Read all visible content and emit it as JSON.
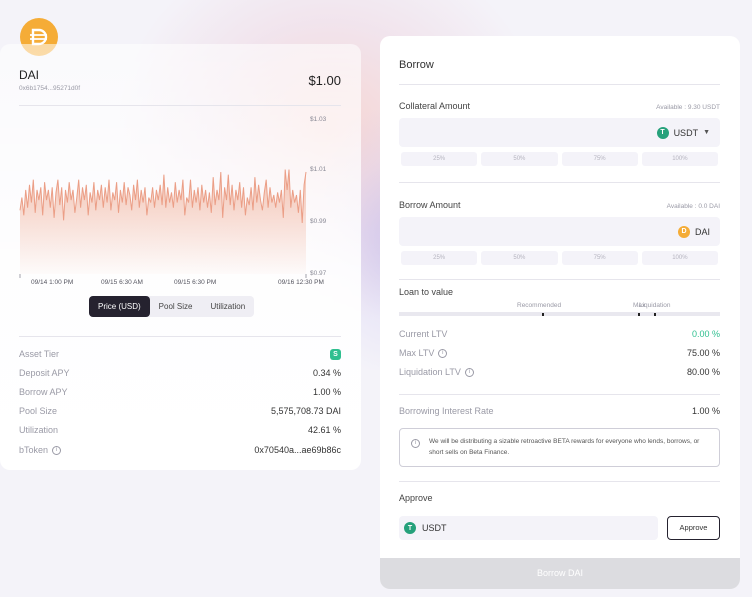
{
  "asset": {
    "name": "DAI",
    "address": "0x6b1754...95271d0f",
    "price": "$1.00",
    "brand_color": "#f5ac37"
  },
  "chart_data": {
    "type": "area",
    "x_tick_labels": [
      "09/14 1:00 PM",
      "09/15 6:30 AM",
      "09/15 6:30 PM",
      "09/16 12:30 PM"
    ],
    "y_tick_labels": [
      "$1.03",
      "$1.01",
      "$0.99",
      "$0.97"
    ],
    "ylim": [
      0.97,
      1.03
    ],
    "fill_color": "#f3c2b1",
    "line_color": "#eb9e86",
    "values": [
      0.995,
      1.0,
      0.993,
      1.003,
      0.996,
      1.005,
      0.998,
      1.007,
      0.994,
      1.003,
      0.999,
      1.004,
      0.993,
      1.006,
      0.999,
      1.003,
      0.996,
      1.004,
      0.992,
      1.002,
      1.007,
      0.997,
      1.004,
      0.991,
      1.003,
      0.998,
      1.006,
      0.999,
      1.003,
      0.994,
      1.0,
      1.007,
      0.996,
      1.004,
      0.999,
      1.005,
      0.993,
      1.002,
      0.998,
      1.006,
      0.995,
      1.003,
      0.999,
      1.005,
      0.996,
      1.004,
      0.998,
      1.007,
      0.995,
      1.002,
      0.999,
      1.006,
      0.994,
      1.003,
      0.998,
      1.006,
      0.997,
      1.004,
      1.001,
      0.995,
      1.005,
      0.999,
      1.007,
      0.996,
      1.003,
      0.998,
      1.004,
      0.993,
      1.0,
      0.998,
      1.004,
      0.996,
      1.003,
      0.999,
      1.005,
      0.997,
      1.009,
      0.996,
      1.004,
      0.998,
      1.002,
      0.996,
      1.006,
      0.998,
      1.003,
      0.999,
      1.007,
      0.993,
      1.0,
      0.998,
      1.007,
      0.996,
      1.003,
      0.998,
      1.004,
      0.995,
      1.005,
      0.998,
      1.003,
      0.996,
      1.002,
      0.994,
      1.008,
      0.997,
      1.003,
      0.999,
      1.01,
      0.992,
      1.004,
      0.999,
      1.009,
      0.997,
      1.005,
      0.995,
      1.003,
      0.999,
      1.006,
      0.996,
      1.004,
      0.993,
      1.0,
      0.997,
      1.004,
      0.995,
      1.008,
      0.998,
      1.005,
      0.999,
      0.995,
      1.002,
      1.007,
      0.996,
      1.004,
      0.998,
      1.001,
      0.996,
      1.002,
      0.998,
      1.003,
      0.992,
      1.011,
      1.003,
      1.011,
      0.996,
      1.003,
      0.998,
      1.001,
      0.994,
      1.003,
      0.99,
      1.005,
      1.01
    ]
  },
  "chart_tabs": [
    {
      "label": "Price (USD)",
      "active": true
    },
    {
      "label": "Pool Size",
      "active": false
    },
    {
      "label": "Utilization",
      "active": false
    }
  ],
  "stats": {
    "asset_tier_label": "Asset Tier",
    "asset_tier_badge": "S",
    "deposit_apy_label": "Deposit APY",
    "deposit_apy": "0.34 %",
    "borrow_apy_label": "Borrow APY",
    "borrow_apy": "1.00 %",
    "pool_size_label": "Pool Size",
    "pool_size": "5,575,708.73 DAI",
    "utilization_label": "Utilization",
    "utilization": "42.61 %",
    "btoken_label": "bToken",
    "btoken": "0x70540a...ae69b86c"
  },
  "borrow": {
    "title": "Borrow",
    "collateral_label": "Collateral Amount",
    "collateral_available": "Available : 9.30 USDT",
    "collateral_token": "USDT",
    "percent_options": [
      "25%",
      "50%",
      "75%",
      "100%"
    ],
    "borrow_label": "Borrow Amount",
    "borrow_available": "Available : 0.0 DAI",
    "borrow_token": "DAI",
    "ltv_title": "Loan to value",
    "ltv_recommended": "Recommended",
    "ltv_max": "Max",
    "ltv_liquidation": "Liquidation",
    "current_ltv_label": "Current LTV",
    "current_ltv": "0.00 %",
    "max_ltv_label": "Max LTV",
    "max_ltv": "75.00 %",
    "liq_ltv_label": "Liquidation LTV",
    "liq_ltv": "80.00 %",
    "interest_label": "Borrowing Interest Rate",
    "interest_rate": "1.00 %",
    "notice": "We will be distributing a sizable retroactive BETA rewards for everyone who lends, borrows, or short sells on Beta Finance.",
    "approve_title": "Approve",
    "approve_token": "USDT",
    "approve_button": "Approve",
    "submit_button": "Borrow DAI"
  },
  "colors": {
    "tether_green": "#26a17b",
    "dai_orange": "#f5ac37",
    "positive_green": "#2fbf8f"
  }
}
